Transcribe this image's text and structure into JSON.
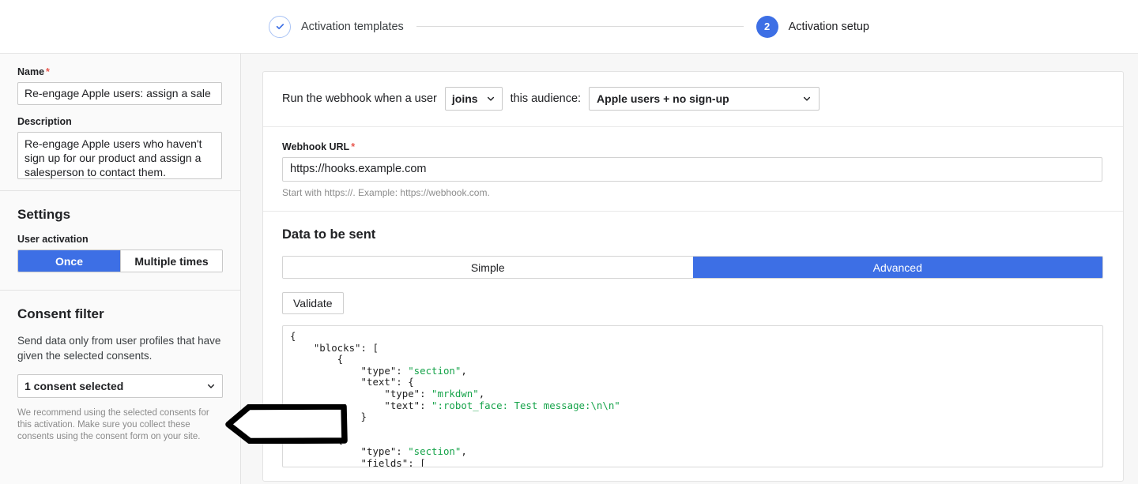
{
  "stepper": {
    "steps": [
      {
        "label": "Activation templates",
        "state": "done",
        "marker": "check-icon"
      },
      {
        "label": "Activation setup",
        "state": "active",
        "marker": "2"
      }
    ]
  },
  "sidebar": {
    "name": {
      "label": "Name",
      "required_marker": "*",
      "value": "Re-engage Apple users: assign a sale"
    },
    "description": {
      "label": "Description",
      "value": "Re-engage Apple users who haven't sign up for our product and assign a salesperson to contact them."
    },
    "settings": {
      "title": "Settings",
      "user_activation_label": "User activation",
      "options": [
        {
          "label": "Once",
          "selected": true
        },
        {
          "label": "Multiple times",
          "selected": false
        }
      ]
    },
    "consent": {
      "title": "Consent filter",
      "description": "Send data only from user profiles that have given the selected consents.",
      "select_value": "1 consent selected",
      "note": "We recommend using the selected consents for this activation. Make sure you collect these consents using the consent form on your site."
    }
  },
  "main": {
    "trigger": {
      "prefix": "Run the webhook when a user",
      "event_value": "joins",
      "middle": "this audience:",
      "audience_value": "Apple users + no sign-up"
    },
    "webhook_url": {
      "label": "Webhook URL",
      "required_marker": "*",
      "value": "https://hooks.example.com",
      "hint": "Start with https://. Example: https://webhook.com."
    },
    "data": {
      "title": "Data to be sent",
      "tabs": [
        {
          "label": "Simple",
          "selected": false
        },
        {
          "label": "Advanced",
          "selected": true
        }
      ],
      "validate_label": "Validate",
      "code": "{\n    \"blocks\": [\n        {\n            \"type\": \"section\",\n            \"text\": {\n                \"type\": \"mrkdwn\",\n                \"text\": \":robot_face: Test message:\\n\\n\"\n            }\n        },\n        {\n            \"type\": \"section\",\n            \"fields\": ["
    }
  },
  "annotation": {
    "shape": "left-pointing-arrow-outline",
    "color": "#000000"
  },
  "colors": {
    "accent_blue": "#3d6fe5",
    "page_bg": "#f7f7f7",
    "sidebar_bg": "#fafafa",
    "required_red": "#e8584f",
    "code_string_green": "#16a34a"
  }
}
